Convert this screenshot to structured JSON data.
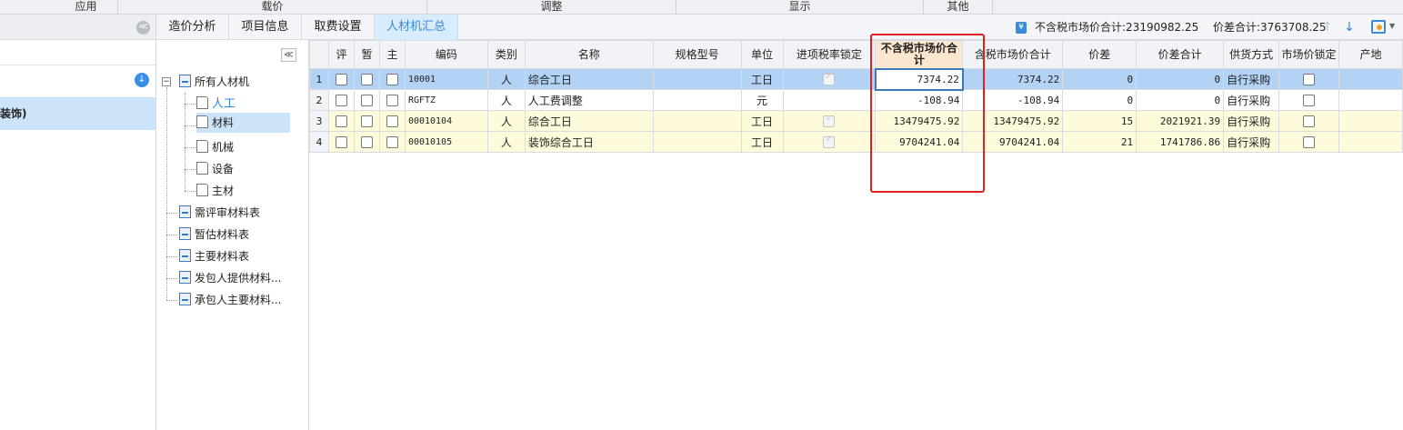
{
  "ribbon": {
    "groups": [
      "应用",
      "载价",
      "调整",
      "显示",
      "其他"
    ]
  },
  "left_panel": {
    "selected_item": "装饰)"
  },
  "tabs": [
    "造价分析",
    "项目信息",
    "取费设置",
    "人材机汇总"
  ],
  "summary": {
    "no_tax_total": "不含税市场价合计:23190982.25",
    "price_diff_total": "价差合计:3763708.25"
  },
  "tree": {
    "root": "所有人材机",
    "children": [
      "人工",
      "材料",
      "机械",
      "设备",
      "主材"
    ],
    "others": [
      "需评审材料表",
      "暂估材料表",
      "主要材料表",
      "发包人提供材料...",
      "承包人主要材料..."
    ]
  },
  "grid": {
    "headers": [
      "评",
      "暂",
      "主",
      "编码",
      "类别",
      "名称",
      "规格型号",
      "单位",
      "进项税率锁定",
      "不含税市场价合计",
      "含税市场价合计",
      "价差",
      "价差合计",
      "供货方式",
      "市场价锁定",
      "产地"
    ],
    "rows": [
      {
        "n": "1",
        "code": "10001",
        "type": "人",
        "name": "综合工日",
        "unit": "工日",
        "no_tax": "7374.22",
        "tax": "7374.22",
        "diff": "0",
        "diff_total": "0",
        "supply": "自行采购"
      },
      {
        "n": "2",
        "code": "RGFTZ",
        "type": "人",
        "name": "人工费调整",
        "unit": "元",
        "no_tax": "-108.94",
        "tax": "-108.94",
        "diff": "0",
        "diff_total": "0",
        "supply": "自行采购"
      },
      {
        "n": "3",
        "code": "00010104",
        "type": "人",
        "name": "综合工日",
        "unit": "工日",
        "no_tax": "13479475.92",
        "tax": "13479475.92",
        "diff": "15",
        "diff_total": "2021921.39",
        "supply": "自行采购"
      },
      {
        "n": "4",
        "code": "00010105",
        "type": "人",
        "name": "装饰综合工日",
        "unit": "工日",
        "no_tax": "9704241.04",
        "tax": "9704241.04",
        "diff": "21",
        "diff_total": "1741786.86",
        "supply": "自行采购"
      }
    ]
  },
  "colors": {
    "accent": "#3a8ad8",
    "highlight_box": "#e02020",
    "selected_row": "#b4d3f4",
    "yellow_row": "#fdfbdc"
  }
}
